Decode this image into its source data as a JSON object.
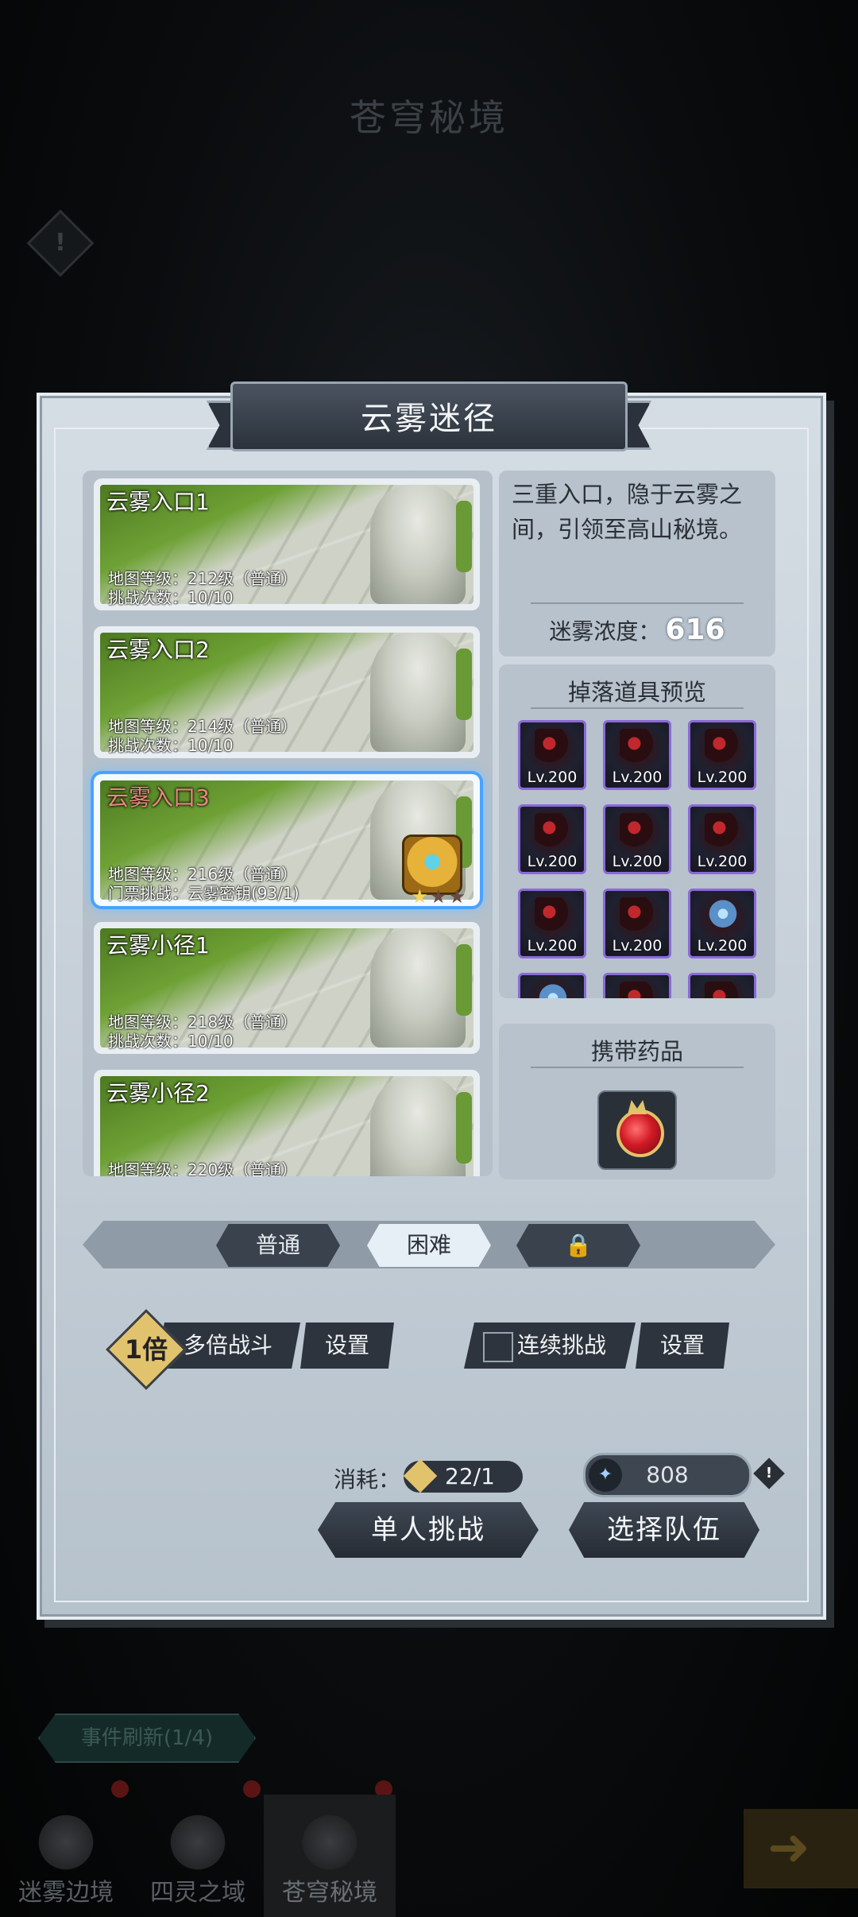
{
  "header": {
    "title": "苍穹秘境",
    "alert_icon": "exclamation-icon"
  },
  "dialog": {
    "title": "云雾迷径",
    "description": "三重入口，隐于云雾之间，引领至高山秘境。",
    "fog_label": "迷雾浓度：",
    "fog_value": "616",
    "drop_title": "掉落道具预览",
    "potion_title": "携带药品"
  },
  "stages": [
    {
      "name": "云雾入口1",
      "line1": "地图等级：212级（普通）",
      "line2": "挑战次数：10/10"
    },
    {
      "name": "云雾入口2",
      "line1": "地图等级：214级（普通）",
      "line2": "挑战次数：10/10"
    },
    {
      "name": "云雾入口3",
      "line1": "地图等级：216级（普通）",
      "line2": "门票挑战：云雾密钥(93/1)",
      "selected": true,
      "stars_filled": 1,
      "stars_total": 3
    },
    {
      "name": "云雾小径1",
      "line1": "地图等级：218级（普通）",
      "line2": "挑战次数：10/10"
    },
    {
      "name": "云雾小径2",
      "line1": "地图等级：220级（普通）",
      "line2": ""
    }
  ],
  "drops": [
    {
      "level": "Lv.200"
    },
    {
      "level": "Lv.200"
    },
    {
      "level": "Lv.200"
    },
    {
      "level": "Lv.200"
    },
    {
      "level": "Lv.200"
    },
    {
      "level": "Lv.200"
    },
    {
      "level": "Lv.200"
    },
    {
      "level": "Lv.200"
    },
    {
      "level": "Lv.200"
    },
    {
      "level": ""
    },
    {
      "level": ""
    },
    {
      "level": ""
    }
  ],
  "difficulty": {
    "normal": "普通",
    "hard": "困难",
    "locked_icon": "lock-icon",
    "selected": "困难"
  },
  "battle": {
    "multiplier": "1倍",
    "multi_label": "多倍战斗",
    "settings_label": "设置",
    "continuous_label": "连续挑战",
    "continuous_checked": false,
    "settings2_label": "设置"
  },
  "cost": {
    "label": "消耗：",
    "value": "22/1",
    "resource_value": "808"
  },
  "actions": {
    "solo": "单人挑战",
    "team": "选择队伍"
  },
  "bottom": {
    "event_refresh": "事件刷新(1/4)",
    "nav": [
      {
        "label": "迷雾边境"
      },
      {
        "label": "四灵之域"
      },
      {
        "label": "苍穹秘境",
        "active": true
      }
    ]
  },
  "colors": {
    "accent_selected": "#4aa2ff",
    "panel": "#c3cdd6",
    "gold": "#e2c36d"
  }
}
